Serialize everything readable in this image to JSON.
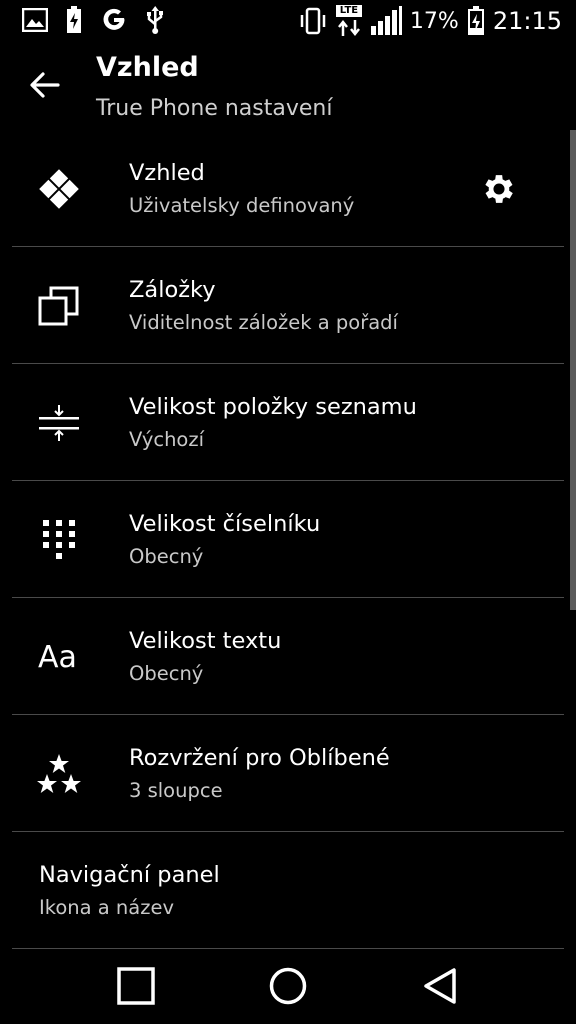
{
  "status_bar": {
    "battery_percent": "17%",
    "time": "21:15",
    "network": "LTE",
    "left_icons": [
      "image-icon",
      "battery-charging-icon",
      "google-icon",
      "usb-icon"
    ],
    "right_icons": [
      "vibrate-icon",
      "lte-icon",
      "signal-icon",
      "battery-icon"
    ]
  },
  "app_bar": {
    "title": "Vzhled",
    "subtitle": "True Phone nastavení"
  },
  "settings": [
    {
      "title": "Vzhled",
      "subtitle": "Uživatelsky definovaný",
      "icon": "diamond-grid-icon",
      "action_icon": "gear-icon"
    },
    {
      "title": "Záložky",
      "subtitle": "Viditelnost záložek a pořadí",
      "icon": "tabs-icon"
    },
    {
      "title": "Velikost položky seznamu",
      "subtitle": "Výchozí",
      "icon": "list-size-icon"
    },
    {
      "title": "Velikost číselníku",
      "subtitle": "Obecný",
      "icon": "dialpad-icon"
    },
    {
      "title": "Velikost textu",
      "subtitle": "Obecný",
      "icon": "text-size-icon",
      "icon_text": "Aa"
    },
    {
      "title": "Rozvržení pro Oblíbené",
      "subtitle": "3 sloupce",
      "icon": "stars-icon"
    },
    {
      "title": "Navigační panel",
      "subtitle": "Ikona a název"
    }
  ],
  "nav_bar": [
    "recents-button",
    "home-button",
    "back-button"
  ]
}
